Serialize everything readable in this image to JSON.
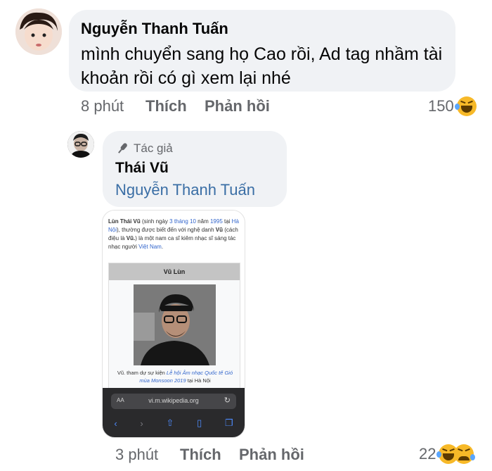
{
  "comment1": {
    "author": "Nguyễn Thanh Tuấn",
    "text": "mình chuyển sang họ Cao rồi, Ad tag nhầm tài khoản rồi có gì xem lại nhé",
    "time": "8 phút",
    "like_label": "Thích",
    "reply_label": "Phản hồi",
    "reaction_count": "150",
    "reaction_icon": "laughing-emoji-icon"
  },
  "reply": {
    "author_badge": "Tác giả",
    "badge_icon": "microphone-icon",
    "author": "Thái Vũ",
    "tagged_user": "Nguyễn Thanh Tuấn",
    "time": "3 phút",
    "like_label": "Thích",
    "reply_label": "Phản hồi",
    "reaction_count": "22",
    "reaction_icons": [
      "laughing-emoji-icon",
      "sad-emoji-icon"
    ],
    "link_color": "#3a6ea5"
  },
  "wiki": {
    "p_name": "Lùn Thái Vũ",
    "p_t1": " (sinh ngày ",
    "p_date": "3 tháng 10",
    "p_t2": " năm ",
    "p_year": "1995",
    "p_t3": " tại ",
    "p_place": "Hà Nội",
    "p_t4": "), thường được biết đến với nghệ danh ",
    "p_stage": "Vũ",
    "p_t5": " (cách điệu là ",
    "p_stage2": "Vũ.",
    "p_t6": ") là một nam ca sĩ kiêm nhạc sĩ sáng tác nhạc người ",
    "p_country": "Việt Nam",
    "p_t7": ".",
    "box_title": "Vũ Lùn",
    "caption_t1": "Vũ. tham dự sự kiện ",
    "caption_event": "Lễ hội Âm nhạc Quốc tế Gió mùa Monsoon 2019",
    "caption_t2": " tại Hà Nội",
    "browser": {
      "aa": "AA",
      "url": "vi.m.wikipedia.org",
      "reload_icon": "reload-icon",
      "nav_icons": [
        "back-icon",
        "forward-icon",
        "share-icon",
        "bookmarks-icon",
        "tabs-icon"
      ]
    }
  }
}
